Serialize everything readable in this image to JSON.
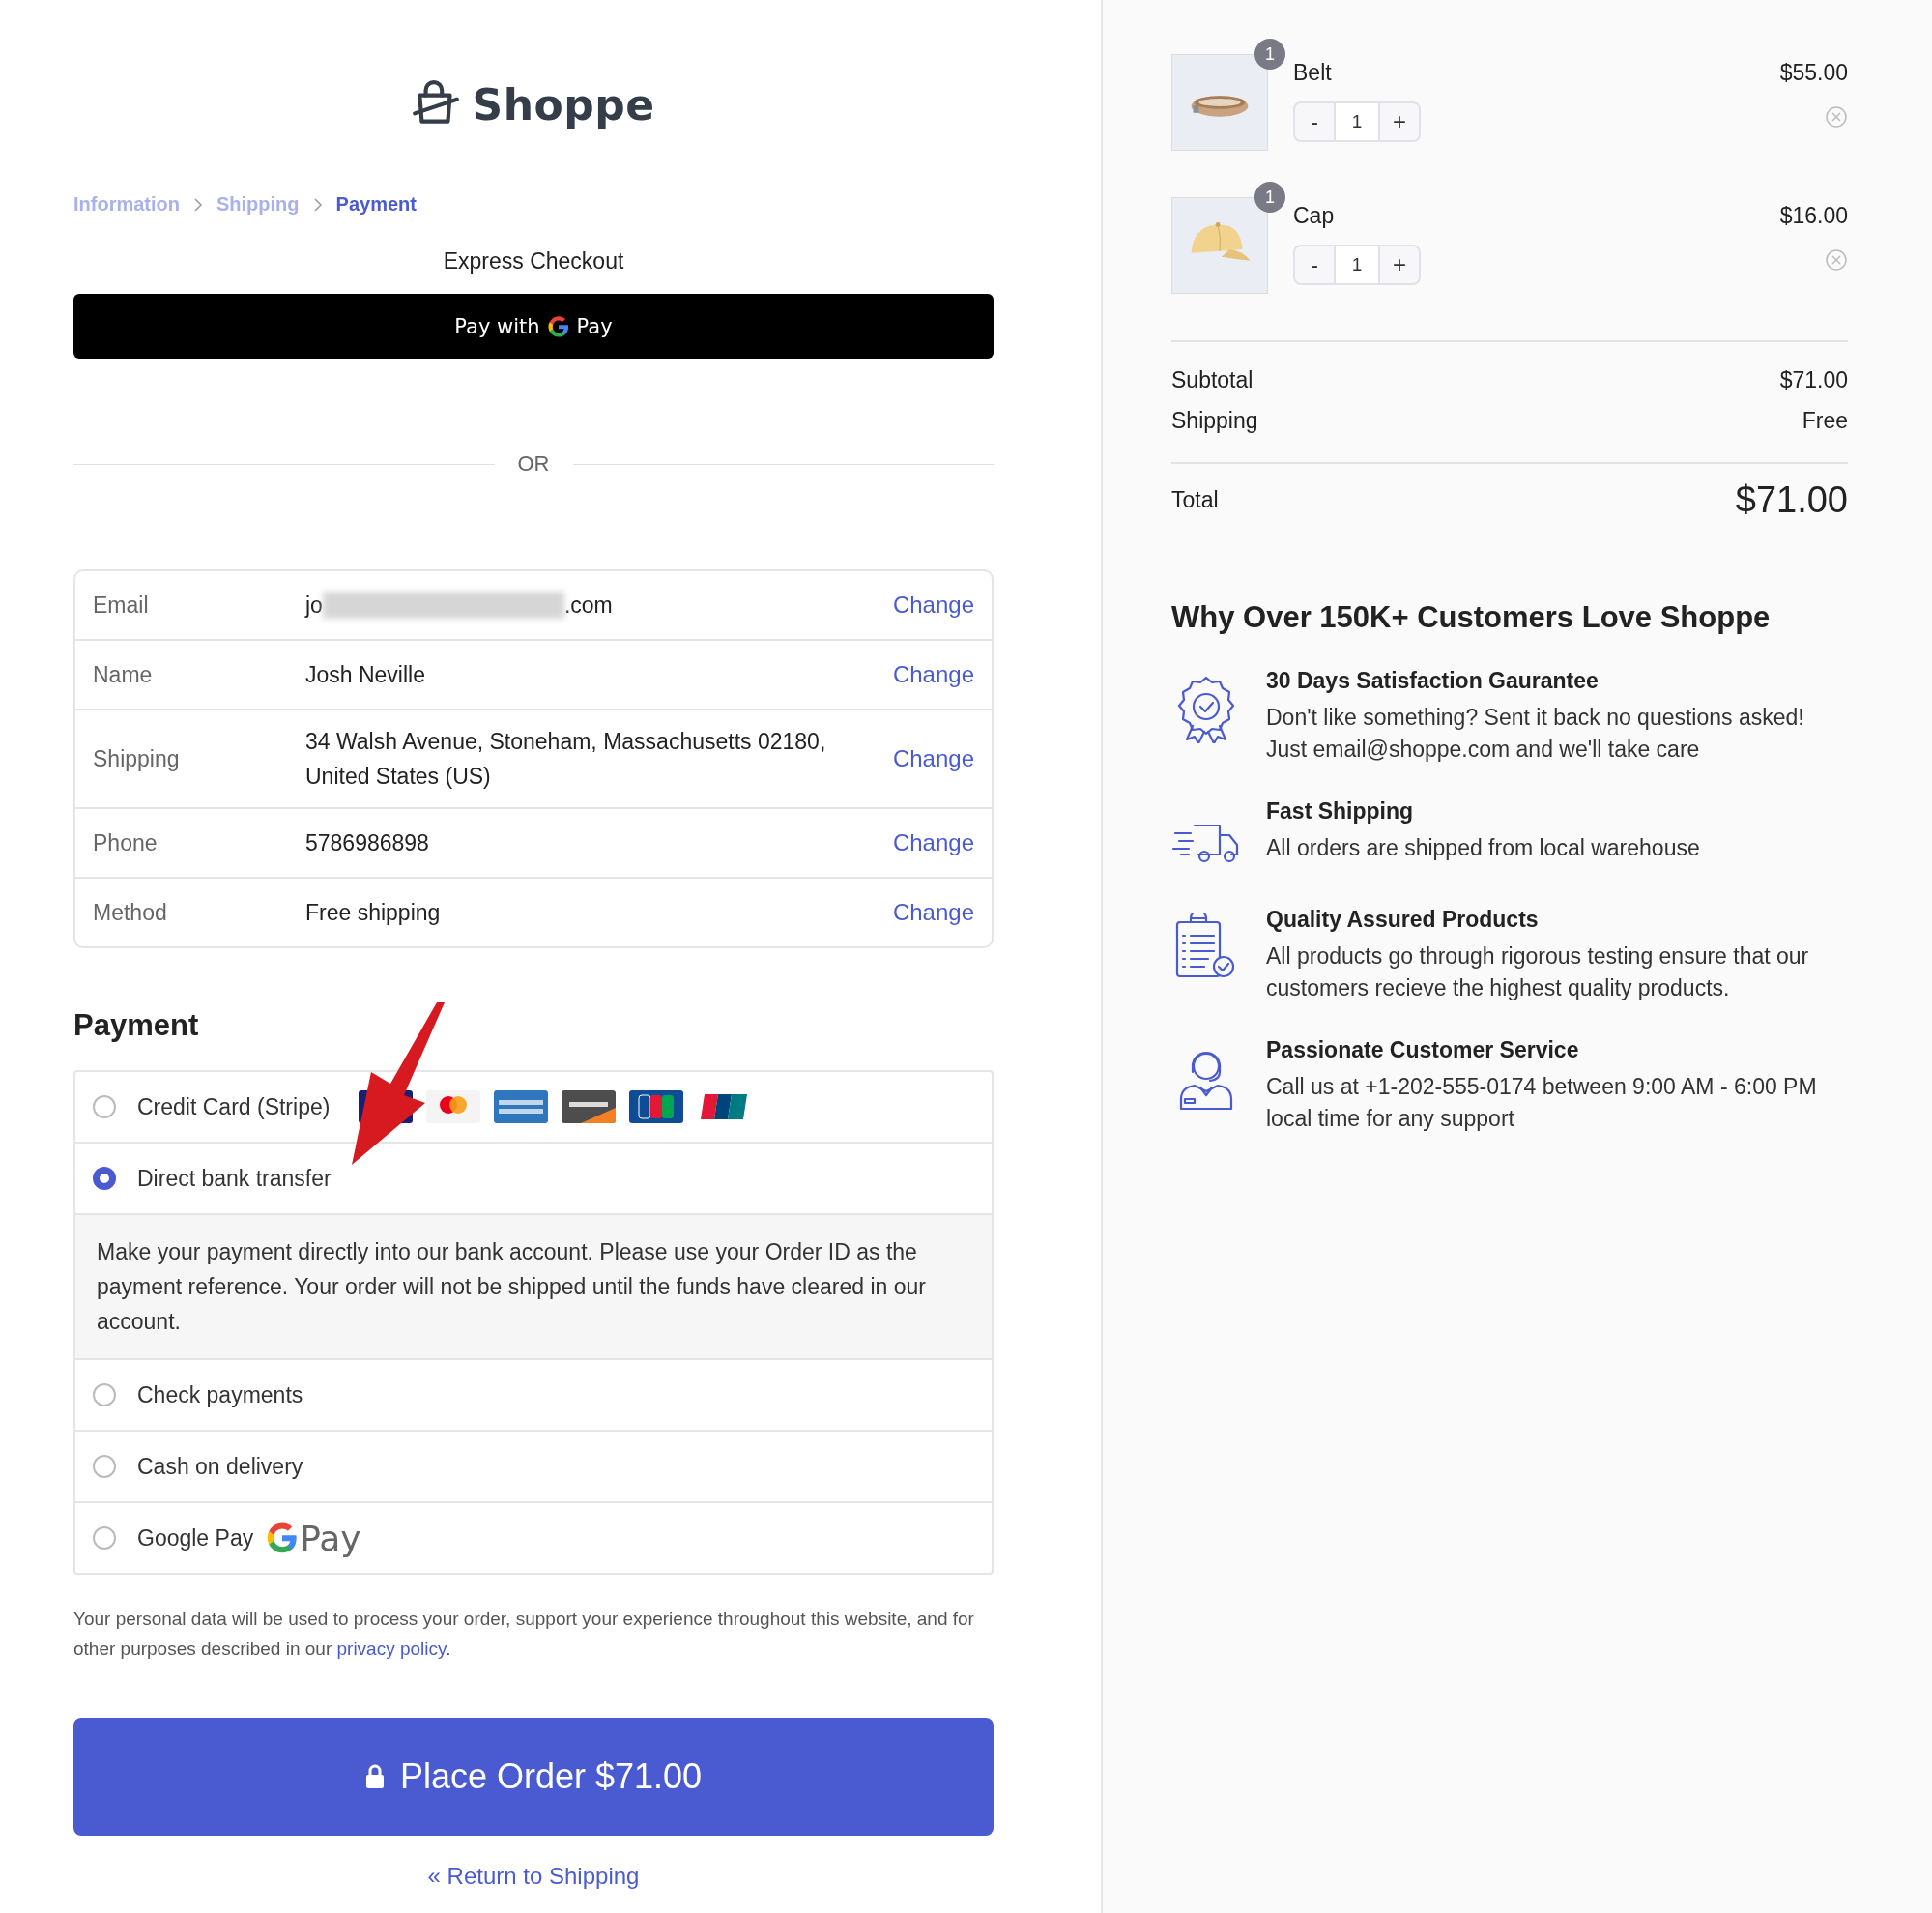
{
  "logo": {
    "text": "Shoppe"
  },
  "breadcrumb": [
    {
      "label": "Information",
      "selected": false
    },
    {
      "label": "Shipping",
      "selected": false
    },
    {
      "label": "Payment",
      "selected": true
    }
  ],
  "express_checkout": {
    "title": "Express Checkout",
    "button_text": "Pay with",
    "button_brand": "Pay"
  },
  "divider_text": "OR",
  "info_rows": [
    {
      "label": "Email",
      "value_parts": [
        "jo",
        ".com"
      ],
      "redacted": true,
      "action": "Change"
    },
    {
      "label": "Name",
      "value_parts": [
        "Josh Neville"
      ],
      "redacted": false,
      "action": "Change"
    },
    {
      "label": "Shipping",
      "value_parts": [
        "34 Walsh Avenue, Stoneham, Massachusetts 02180, United States (US)"
      ],
      "redacted": false,
      "action": "Change"
    },
    {
      "label": "Phone",
      "value_parts": [
        "5786986898"
      ],
      "redacted": false,
      "action": "Change"
    },
    {
      "label": "Method",
      "value_parts": [
        "Free shipping"
      ],
      "redacted": false,
      "action": "Change"
    }
  ],
  "payment": {
    "title": "Payment",
    "options": [
      {
        "kind": "cards",
        "label": "Credit Card (Stripe)",
        "selected": false
      },
      {
        "kind": "plain",
        "label": "Direct bank transfer",
        "selected": true,
        "description": "Make your payment directly into our bank account. Please use your Order ID as the payment reference. Your order will not be shipped until the funds have cleared in our account."
      },
      {
        "kind": "plain",
        "label": "Check payments",
        "selected": false
      },
      {
        "kind": "plain",
        "label": "Cash on delivery",
        "selected": false
      },
      {
        "kind": "gpay",
        "label": "Google Pay",
        "brand": "Pay",
        "selected": false
      }
    ]
  },
  "privacy_note": "Your personal data will be used to process your order, support your experience throughout this website, and for other purposes described in our ",
  "privacy_link": "privacy policy",
  "privacy_end": ".",
  "place_order": {
    "label": "Place Order",
    "amount": "$71.00"
  },
  "return_link": "« Return to Shipping",
  "cart": {
    "items": [
      {
        "kind": "belt",
        "name": "Belt",
        "price": "$55.00",
        "count": "1",
        "minus": "-",
        "quantity": "1",
        "plus": "+"
      },
      {
        "kind": "cap",
        "name": "Cap",
        "price": "$16.00",
        "count": "1",
        "minus": "-",
        "quantity": "1",
        "plus": "+"
      }
    ],
    "summary": [
      {
        "label": "Subtotal",
        "value": "$71.00"
      },
      {
        "label": "Shipping",
        "value": "Free"
      }
    ],
    "total": {
      "label": "Total",
      "value": "$71.00"
    }
  },
  "why": {
    "title": "Why Over 150K+ Customers Love Shoppe",
    "features": [
      {
        "kind": "badge",
        "title": "30 Days Satisfaction Gaurantee",
        "text": "Don't like something? Sent it back no questions asked! Just email@shoppe.com and we'll take care"
      },
      {
        "kind": "truck",
        "title": "Fast Shipping",
        "text": "All orders are shipped from local warehouse"
      },
      {
        "kind": "clipboard",
        "title": "Quality Assured Products",
        "text": "All products go through rigorous testing ensure that our customers recieve the highest quality products."
      },
      {
        "kind": "agent",
        "title": "Passionate Customer Service",
        "text": "Call us at +1-202-555-0174 between 9:00 AM - 6:00 PM local time for any support"
      }
    ]
  }
}
